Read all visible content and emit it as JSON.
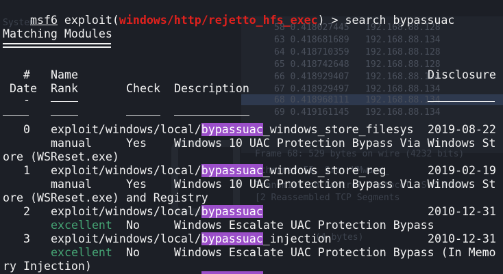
{
  "prompt": {
    "name": "msf6",
    "context_pre": " exploit(",
    "module": "windows/http/rejetto_hfs_exec",
    "context_post": ") > ",
    "command": "search bypassuac"
  },
  "section_title": "Matching Modules",
  "headers": {
    "num": "#",
    "name": "Name",
    "disclosure": "Disclosure",
    "date": "Date",
    "rank": "Rank",
    "check": "Check",
    "description": "Description",
    "num_dash": "-"
  },
  "rows": [
    {
      "num": "0",
      "path_pre": "exploit/windows/local/",
      "path_hl": "bypassuac",
      "path_post": "_windows_store_filesys",
      "date": "2019-08-22",
      "rank": "manual",
      "check": "Yes",
      "desc_line1": "Windows 10 UAC Protection Bypass Via Windows St",
      "desc_line2": "ore (WSReset.exe)"
    },
    {
      "num": "1",
      "path_pre": "exploit/windows/local/",
      "path_hl": "bypassuac",
      "path_post": "_windows_store_reg",
      "date": "2019-02-19",
      "rank": "manual",
      "check": "Yes",
      "desc_line1": "Windows 10 UAC Protection Bypass Via Windows St",
      "desc_line2": "ore (WSReset.exe) and Registry"
    },
    {
      "num": "2",
      "path_pre": "exploit/windows/local/",
      "path_hl": "bypassuac",
      "path_post": "",
      "date": "2010-12-31",
      "rank": "excellent",
      "check": "No",
      "desc_line1": "Windows Escalate UAC Protection Bypass",
      "desc_line2": ""
    },
    {
      "num": "3",
      "path_pre": "exploit/windows/local/",
      "path_hl": "bypassuac",
      "path_post": "_injection",
      "date": "2010-12-31",
      "rank": "excellent",
      "check": "No",
      "desc_line1": "Windows Escalate UAC Protection Bypass (In Memo",
      "desc_line2": "ry Injection)"
    }
  ],
  "background": {
    "rows": [
      "58 0.418027445   192.168.88.128",
      "63 0.418681689   192.168.88.134",
      "64 0.418710359   192.168.88.128",
      "65 0.418742648   192.168.88.128",
      "66 0.418929407   192.168.88.134",
      "67 0.418929497   192.168.88.134",
      "68 0.418968111   192.168.88.134",
      "69 0.419161145   192.168.88.134"
    ],
    "details": [
      "Frame 68: 529 bytes on wire (4232 bits)",
      "Ethernet II, Src: VMware_",
      "Transmission Control Protocol, Src Port",
      "[2 Reassembled TCP Segments",
      "(4 bytes)"
    ],
    "system_label": "System",
    "highlight_color": "#9b4fc9",
    "module_color": "#e0211d",
    "rank_excellent_color": "#46a675"
  }
}
